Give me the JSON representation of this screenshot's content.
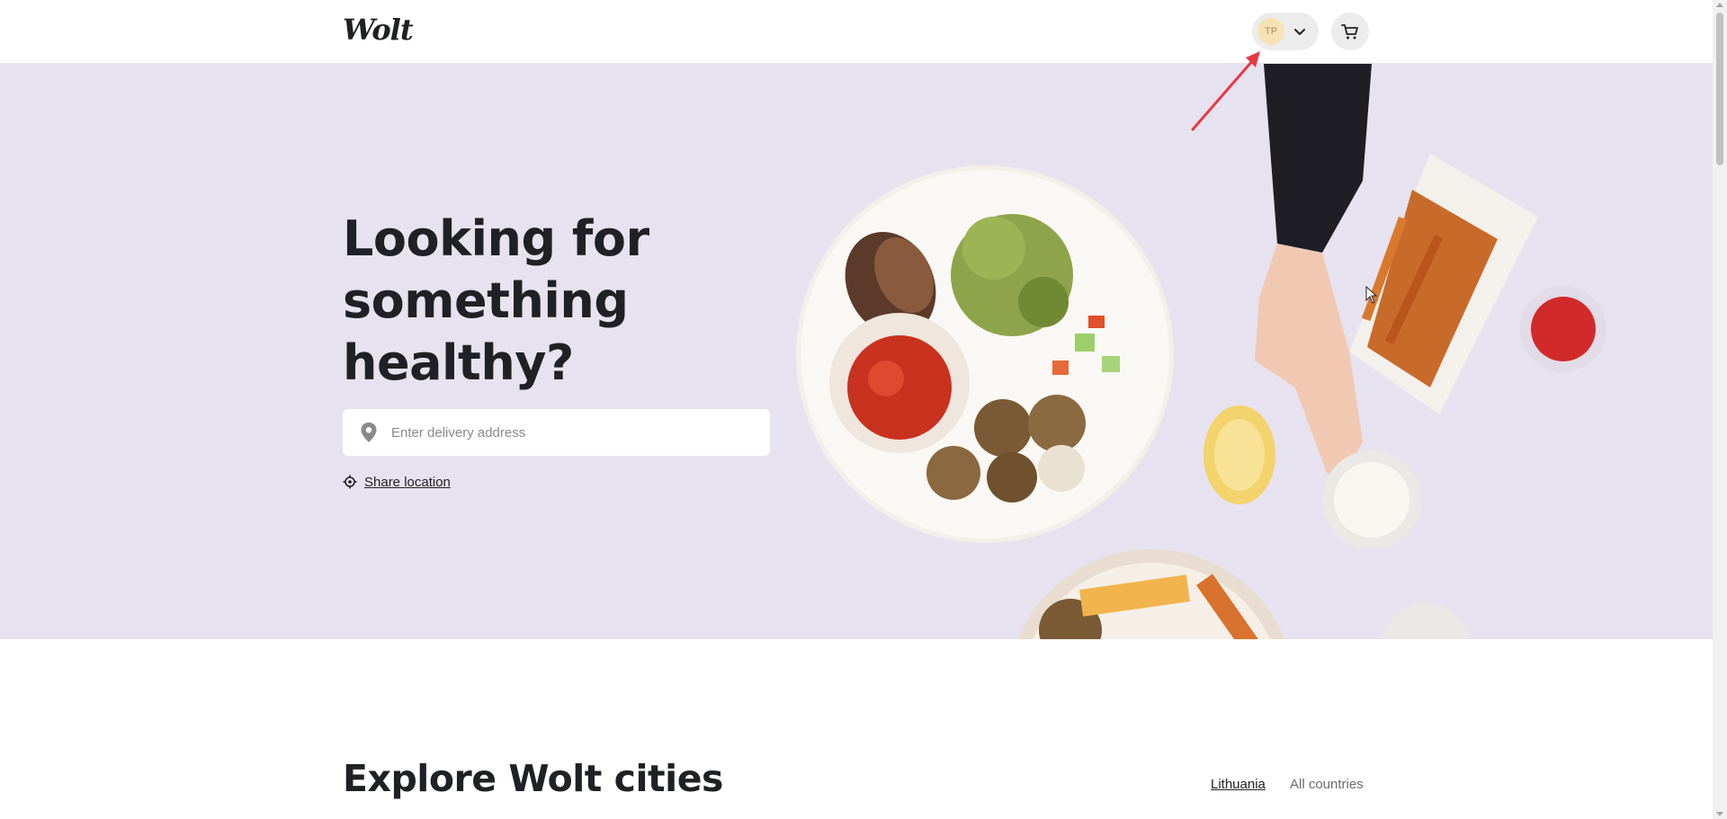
{
  "header": {
    "logo": "Wolt",
    "user_initials": "TP"
  },
  "hero": {
    "title": "Looking for something healthy?",
    "address_placeholder": "Enter delivery address",
    "share_location": "Share location",
    "background_color": "#e7e2ef"
  },
  "explore": {
    "title": "Explore Wolt cities",
    "tabs": [
      "Lithuania",
      "All countries"
    ],
    "active_tab": "Lithuania"
  },
  "colors": {
    "text": "#202125",
    "annotation_arrow": "#e63946",
    "avatar_bg": "#f6e2b5"
  },
  "icons": {
    "chevron": "chevron-down-icon",
    "cart": "cart-icon",
    "pin": "map-pin-icon",
    "locate": "crosshair-icon"
  }
}
